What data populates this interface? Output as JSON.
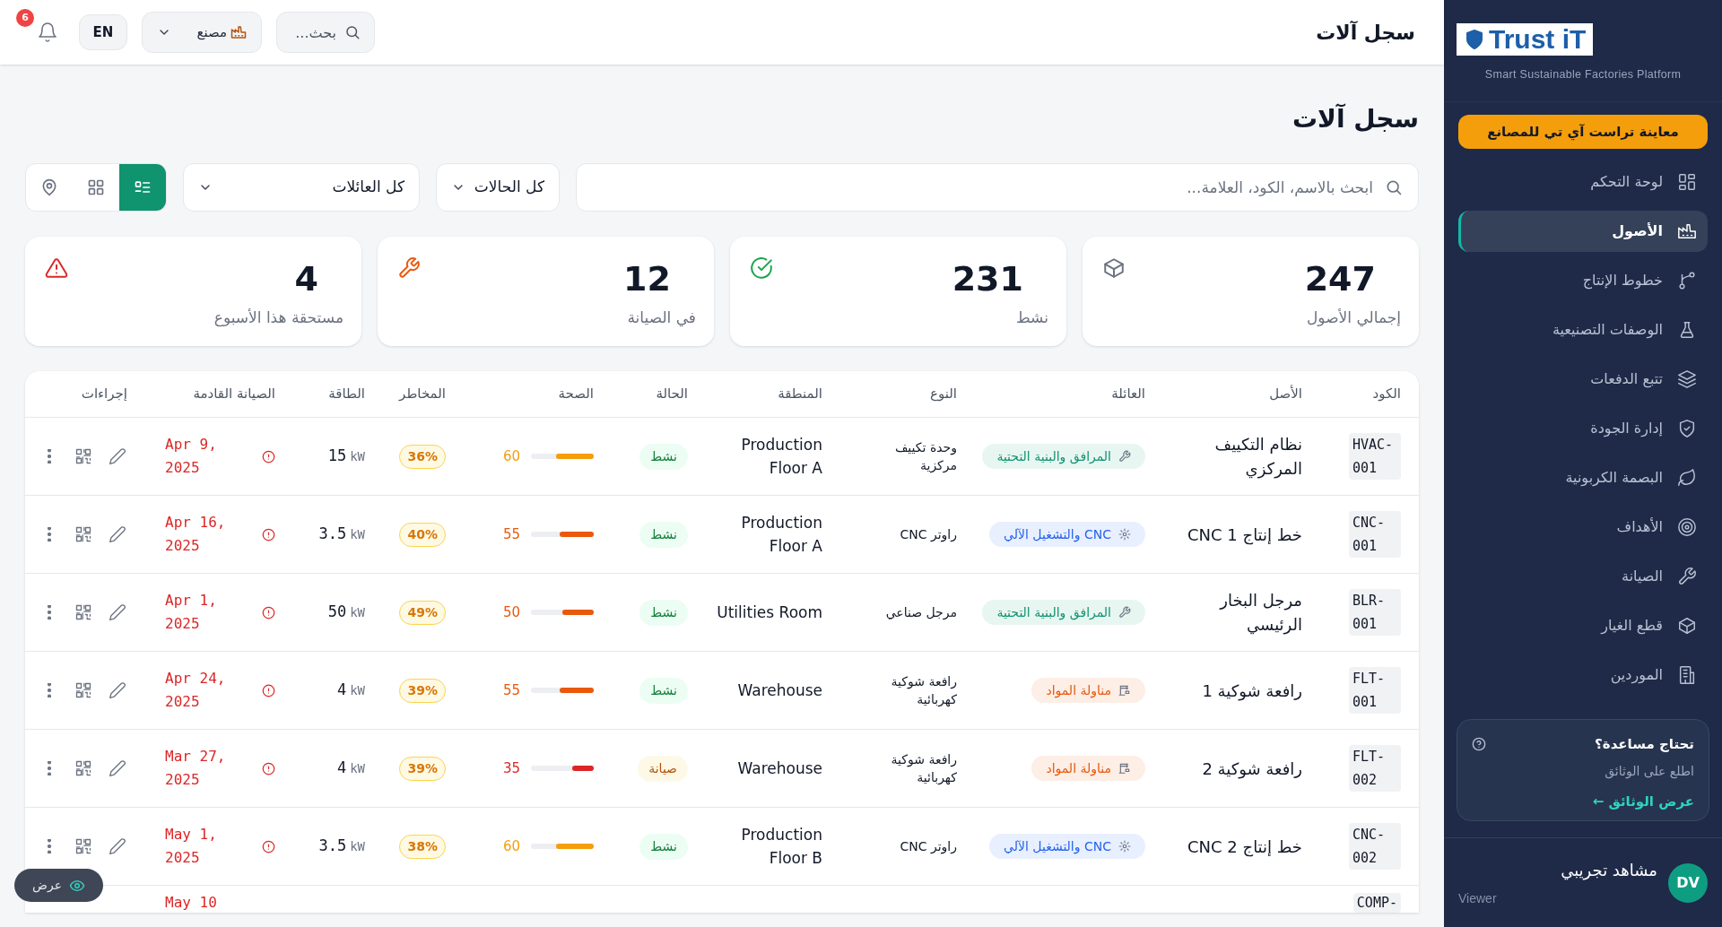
{
  "topbar": {
    "title": "سجل آلات",
    "search": {
      "placeholder": "بحث..."
    },
    "factory": "مصنع",
    "language": "EN",
    "notifications": "6"
  },
  "page": {
    "title": "سجل آلات"
  },
  "filters": {
    "search": {
      "placeholder": "ابحث بالاسم، الكود، العلامة..."
    },
    "status": "كل الحالات",
    "family": "كل العائلات",
    "views": [
      {
        "kind": "list",
        "selected": true
      },
      {
        "kind": "grid",
        "selected": false
      },
      {
        "kind": "map",
        "selected": false
      }
    ]
  },
  "stats": [
    {
      "kind": "total",
      "value": "247",
      "label": "إجمالي الأصول"
    },
    {
      "kind": "active",
      "value": "231",
      "label": "نشط"
    },
    {
      "kind": "maintenance",
      "value": "12",
      "label": "في الصيانة"
    },
    {
      "kind": "due",
      "value": "4",
      "label": "مستحقة هذا الأسبوع"
    }
  ],
  "table": {
    "columns": [
      "الكود",
      "الأصل",
      "العائلة",
      "النوع",
      "المنطقة",
      "الحالة",
      "الصحة",
      "المخاطر",
      "الطاقة",
      "الصيانة القادمة",
      "إجراءات"
    ],
    "rows": [
      {
        "code": "HVAC-001",
        "asset": "نظام التكييف المركزي",
        "family": {
          "kind": "utilities",
          "label": "المرافق والبنية التحتية"
        },
        "type": "وحدة تكييف مركزية",
        "zone": "Production Floor A",
        "status": {
          "kind": "active",
          "label": "نشط"
        },
        "health": "60",
        "level": 0.6,
        "risk": "36%",
        "power": "15",
        "unit": "kW",
        "next": "Apr 9, 2025"
      },
      {
        "code": "CNC-001",
        "asset": "خط إنتاج CNC 1",
        "family": {
          "kind": "cnc",
          "label": "CNC والتشغيل الآلي"
        },
        "type": "راوتر CNC",
        "zone": "Production Floor A",
        "status": {
          "kind": "active",
          "label": "نشط"
        },
        "health": "55",
        "level": 0.55,
        "risk": "40%",
        "power": "3.5",
        "unit": "kW",
        "next": "Apr 16, 2025"
      },
      {
        "code": "BLR-001",
        "asset": "مرجل البخار الرئيسي",
        "family": {
          "kind": "utilities",
          "label": "المرافق والبنية التحتية"
        },
        "type": "مرجل صناعي",
        "zone": "Utilities Room",
        "status": {
          "kind": "active",
          "label": "نشط"
        },
        "health": "50",
        "level": 0.5,
        "risk": "49%",
        "power": "50",
        "unit": "kW",
        "next": "Apr 1, 2025"
      },
      {
        "code": "FLT-001",
        "asset": "رافعة شوكية 1",
        "family": {
          "kind": "materials",
          "label": "مناولة المواد"
        },
        "type": "رافعة شوكية كهربائية",
        "zone": "Warehouse",
        "status": {
          "kind": "active",
          "label": "نشط"
        },
        "health": "55",
        "level": 0.55,
        "risk": "39%",
        "power": "4",
        "unit": "kW",
        "next": "Apr 24, 2025"
      },
      {
        "code": "FLT-002",
        "asset": "رافعة شوكية 2",
        "family": {
          "kind": "materials",
          "label": "مناولة المواد"
        },
        "type": "رافعة شوكية كهربائية",
        "zone": "Warehouse",
        "status": {
          "kind": "maintenance",
          "label": "صيانة"
        },
        "health": "35",
        "level": 0.35,
        "risk": "39%",
        "power": "4",
        "unit": "kW",
        "next": "Mar 27, 2025"
      },
      {
        "code": "CNC-002",
        "asset": "خط إنتاج CNC 2",
        "family": {
          "kind": "cnc",
          "label": "CNC والتشغيل الآلي"
        },
        "type": "راوتر CNC",
        "zone": "Production Floor B",
        "status": {
          "kind": "active",
          "label": "نشط"
        },
        "health": "60",
        "level": 0.6,
        "risk": "38%",
        "power": "3.5",
        "unit": "kW",
        "next": "May 1, 2025"
      }
    ],
    "partial_row": {
      "code": "COMP-",
      "next": "May 10"
    }
  },
  "view_button": "عرض",
  "sidebar": {
    "logo": "Trust iT",
    "tagline": "Smart Sustainable Factories Platform",
    "preview_button": "معاينة تراست آي تي للمصانع",
    "items": [
      {
        "kind": "dashboard",
        "label": "لوحة التحكم",
        "selected": false
      },
      {
        "kind": "factory",
        "label": "الأصول",
        "selected": true
      },
      {
        "kind": "lines",
        "label": "خطوط الإنتاج",
        "selected": false
      },
      {
        "kind": "recipes",
        "label": "الوصفات التصنيعية",
        "selected": false
      },
      {
        "kind": "batches",
        "label": "تتبع الدفعات",
        "selected": false
      },
      {
        "kind": "quality",
        "label": "إدارة الجودة",
        "selected": false
      },
      {
        "kind": "carbon",
        "label": "البصمة الكربونية",
        "selected": false
      },
      {
        "kind": "goals",
        "label": "الأهداف",
        "selected": false
      },
      {
        "kind": "maintenance",
        "label": "الصيانة",
        "selected": false
      },
      {
        "kind": "parts",
        "label": "قطع الغيار",
        "selected": false
      },
      {
        "kind": "suppliers",
        "label": "الموردين",
        "selected": false
      }
    ],
    "help": {
      "title": "تحتاج مساعدة؟",
      "text": "اطلع على الوثائق",
      "link": "عرض الوثائق ←"
    },
    "user": {
      "initials": "DV",
      "name": "مشاهد تجريبي",
      "role": "Viewer"
    }
  }
}
